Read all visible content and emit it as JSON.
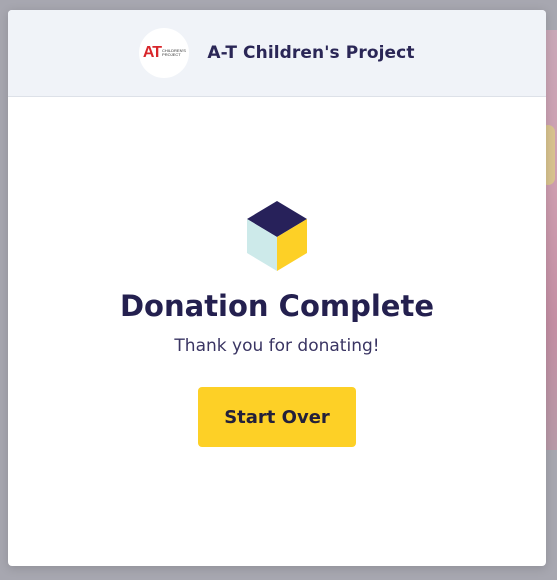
{
  "header": {
    "org_name": "A-T Children's Project",
    "logo": {
      "at_text": "AT",
      "small_text_line1": "CHILDREN'S",
      "small_text_line2": "PROJECT"
    }
  },
  "main": {
    "icon": "cube-icon",
    "title": "Donation Complete",
    "subtitle": "Thank you for donating!",
    "start_over_label": "Start Over"
  },
  "colors": {
    "accent_button": "#fdd026",
    "heading_text": "#24204f",
    "header_background": "#f0f3f8",
    "cube_top": "#27215a",
    "cube_left": "#cdeaea",
    "cube_right": "#fdd026",
    "logo_red": "#d8262b"
  }
}
